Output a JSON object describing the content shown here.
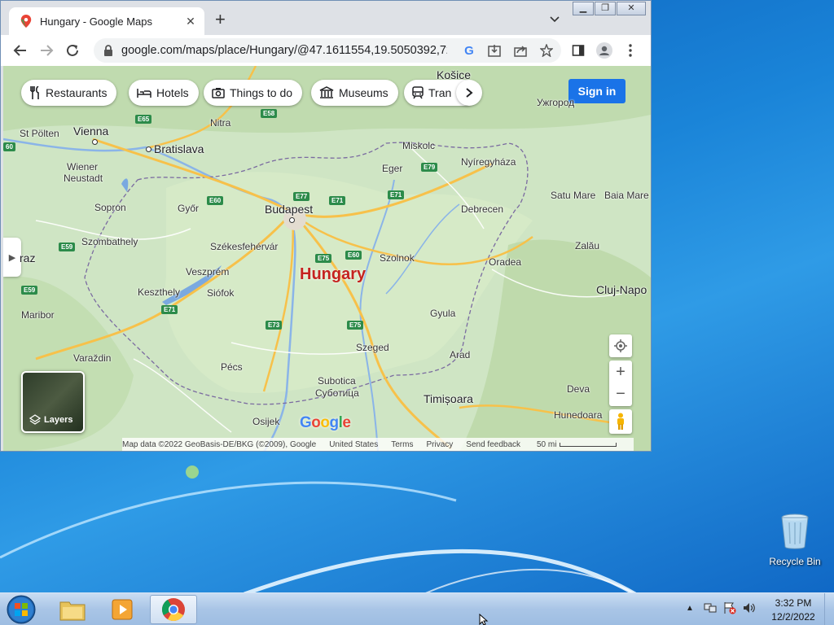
{
  "browser": {
    "tab_title": "Hungary - Google Maps",
    "url": "google.com/maps/place/Hungary/@47.1611554,19.5050392,7z/..."
  },
  "map": {
    "chips": [
      "Restaurants",
      "Hotels",
      "Things to do",
      "Museums",
      "Tran"
    ],
    "sign_in": "Sign in",
    "country_label": "Hungary",
    "layers_label": "Layers",
    "logo": "Google",
    "cities": {
      "kosice": "Košice",
      "uzhhorod": "Ужгород",
      "vienna": "Vienna",
      "st_polten": "St Pölten",
      "nitra": "Nitra",
      "bratislava": "Bratislava",
      "miskolc": "Miskolc",
      "nyiregyhaza": "Nyíregyháza",
      "eger": "Eger",
      "wiener_neustadt_1": "Wiener",
      "wiener_neustadt_2": "Neustadt",
      "budapest": "Budapest",
      "satu_mare": "Satu Mare",
      "baia_mare": "Baia Mare",
      "sopron": "Sopron",
      "gyor": "Győr",
      "debrecen": "Debrecen",
      "szombathely": "Szombathely",
      "szekesfehervar": "Székesfehérvár",
      "zalau": "Zalău",
      "graz": "raz",
      "szolnok": "Szolnok",
      "oradea": "Oradea",
      "veszprem": "Veszprém",
      "keszthely": "Keszthely",
      "siofok": "Siófok",
      "cluj": "Cluj-Napo",
      "maribor": "Maribor",
      "gyula": "Gyula",
      "varazdin": "Varaždin",
      "szeged": "Szeged",
      "arad": "Arad",
      "pecs": "Pécs",
      "subotica_1": "Subotica",
      "subotica_2": "Суботица",
      "deva": "Deva",
      "timisoara": "Timișoara",
      "hunedoara": "Hunedoara",
      "osijek": "Osijek"
    },
    "roads": [
      "E65",
      "E58",
      "E77",
      "E71",
      "E79",
      "E60",
      "E71",
      "E59",
      "E75",
      "E60",
      "E59",
      "E71",
      "E73",
      "E75",
      "60"
    ],
    "attribution": {
      "data": "Map data ©2022 GeoBasis-DE/BKG (©2009), Google",
      "country": "United States",
      "terms": "Terms",
      "privacy": "Privacy",
      "feedback": "Send feedback",
      "scale": "50 mi"
    }
  },
  "desktop": {
    "recycle_bin": "Recycle Bin"
  },
  "taskbar": {
    "time": "3:32 PM",
    "date": "12/2/2022"
  }
}
